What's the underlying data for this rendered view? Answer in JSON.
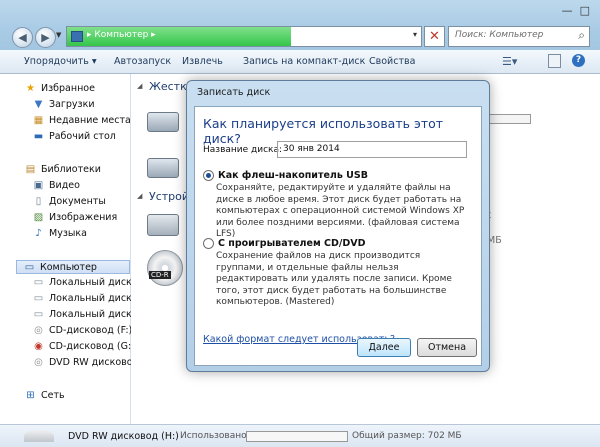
{
  "window": {
    "address_text": "▸ Компьютер ▸",
    "search_placeholder": "Поиск: Компьютер"
  },
  "toolbar": {
    "organize": "Упорядочить ▾",
    "autoplay": "Автозапуск",
    "eject": "Извлечь",
    "burn": "Запись на компакт-диск",
    "properties": "Свойства"
  },
  "sidebar": {
    "favorites": "Избранное",
    "downloads": "Загрузки",
    "recent": "Недавние места",
    "desktop": "Рабочий стол",
    "libraries": "Библиотеки",
    "video": "Видео",
    "documents": "Документы",
    "pictures": "Изображения",
    "music": "Музыка",
    "computer": "Компьютер",
    "local_c": "Локальный диск (C",
    "local_d": "Локальный диск (D",
    "local_e": "Локальный диск (E:",
    "cd_f": "CD-дисковод (F:)",
    "cd_g": "CD-дисковод (G:) C",
    "dvd_h": "DVD RW дисковод (",
    "network": "Сеть"
  },
  "main": {
    "hard_drives_group": "Жестки",
    "devices_group": "Устрой",
    "cd_label": "CD-R",
    "right_t": "t",
    "right_mb": "МБ"
  },
  "status": {
    "drive_name": "DVD RW дисковод (H:)",
    "used_label": "Использовано:",
    "total_size": "Общий размер: 702 МБ"
  },
  "dialog": {
    "title": "Записать диск",
    "heading": "Как планируется использовать этот диск?",
    "name_label": "Название диска:",
    "name_value": "30 янв 2014",
    "option1_title": "Как флеш-накопитель USB",
    "option1_desc": "Сохраняйте, редактируйте и удаляйте файлы на диске в любое время. Этот диск будет работать на компьютерах с операционной системой Windows XP или более поздними версиями. (файловая система LFS)",
    "option2_title": "С проигрывателем CD/DVD",
    "option2_desc": "Сохранение файлов на диск производится группами, и отдельные файлы нельзя редактировать или удалять после записи. Кроме того, этот диск будет работать на большинстве компьютеров. (Mastered)",
    "help_link": "Какой формат следует использовать?",
    "next_button": "Далее",
    "cancel_button": "Отмена",
    "selected_option": 1
  }
}
